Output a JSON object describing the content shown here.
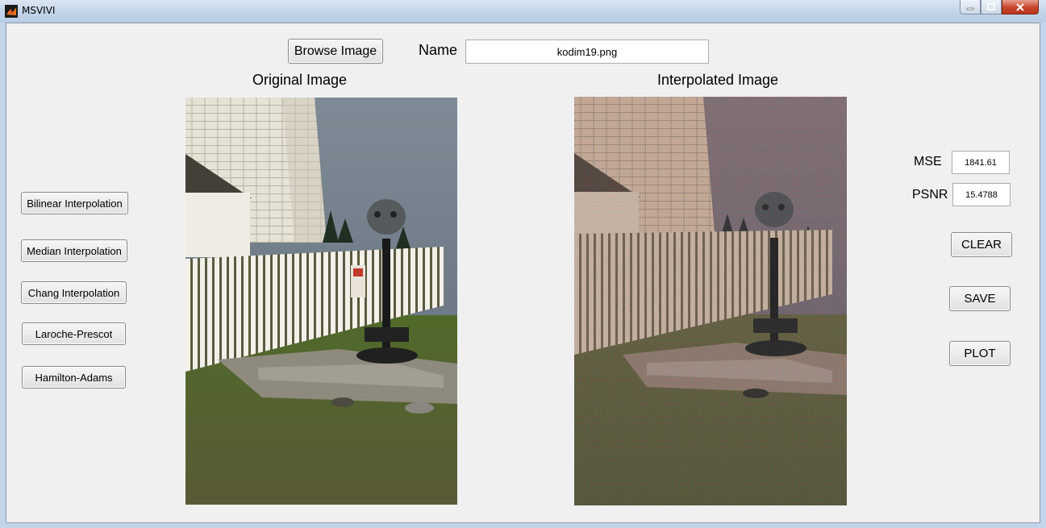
{
  "window": {
    "title": "MSVIVI",
    "accent": "#c4d5ea"
  },
  "top": {
    "browse_label": "Browse Image",
    "name_label": "Name",
    "name_value": "kodim19.png"
  },
  "panels": {
    "original_title": "Original Image",
    "interpolated_title": "Interpolated Image"
  },
  "methods": [
    {
      "label": "Bilinear Interpolation"
    },
    {
      "label": "Median Interpolation"
    },
    {
      "label": "Chang Interpolation"
    },
    {
      "label": "Laroche-Prescot"
    },
    {
      "label": "Hamilton-Adams"
    }
  ],
  "metrics": {
    "mse_label": "MSE",
    "mse_value": "1841.61",
    "psnr_label": "PSNR",
    "psnr_value": "15.4788"
  },
  "actions": {
    "clear_label": "CLEAR",
    "save_label": "SAVE",
    "plot_label": "PLOT"
  }
}
